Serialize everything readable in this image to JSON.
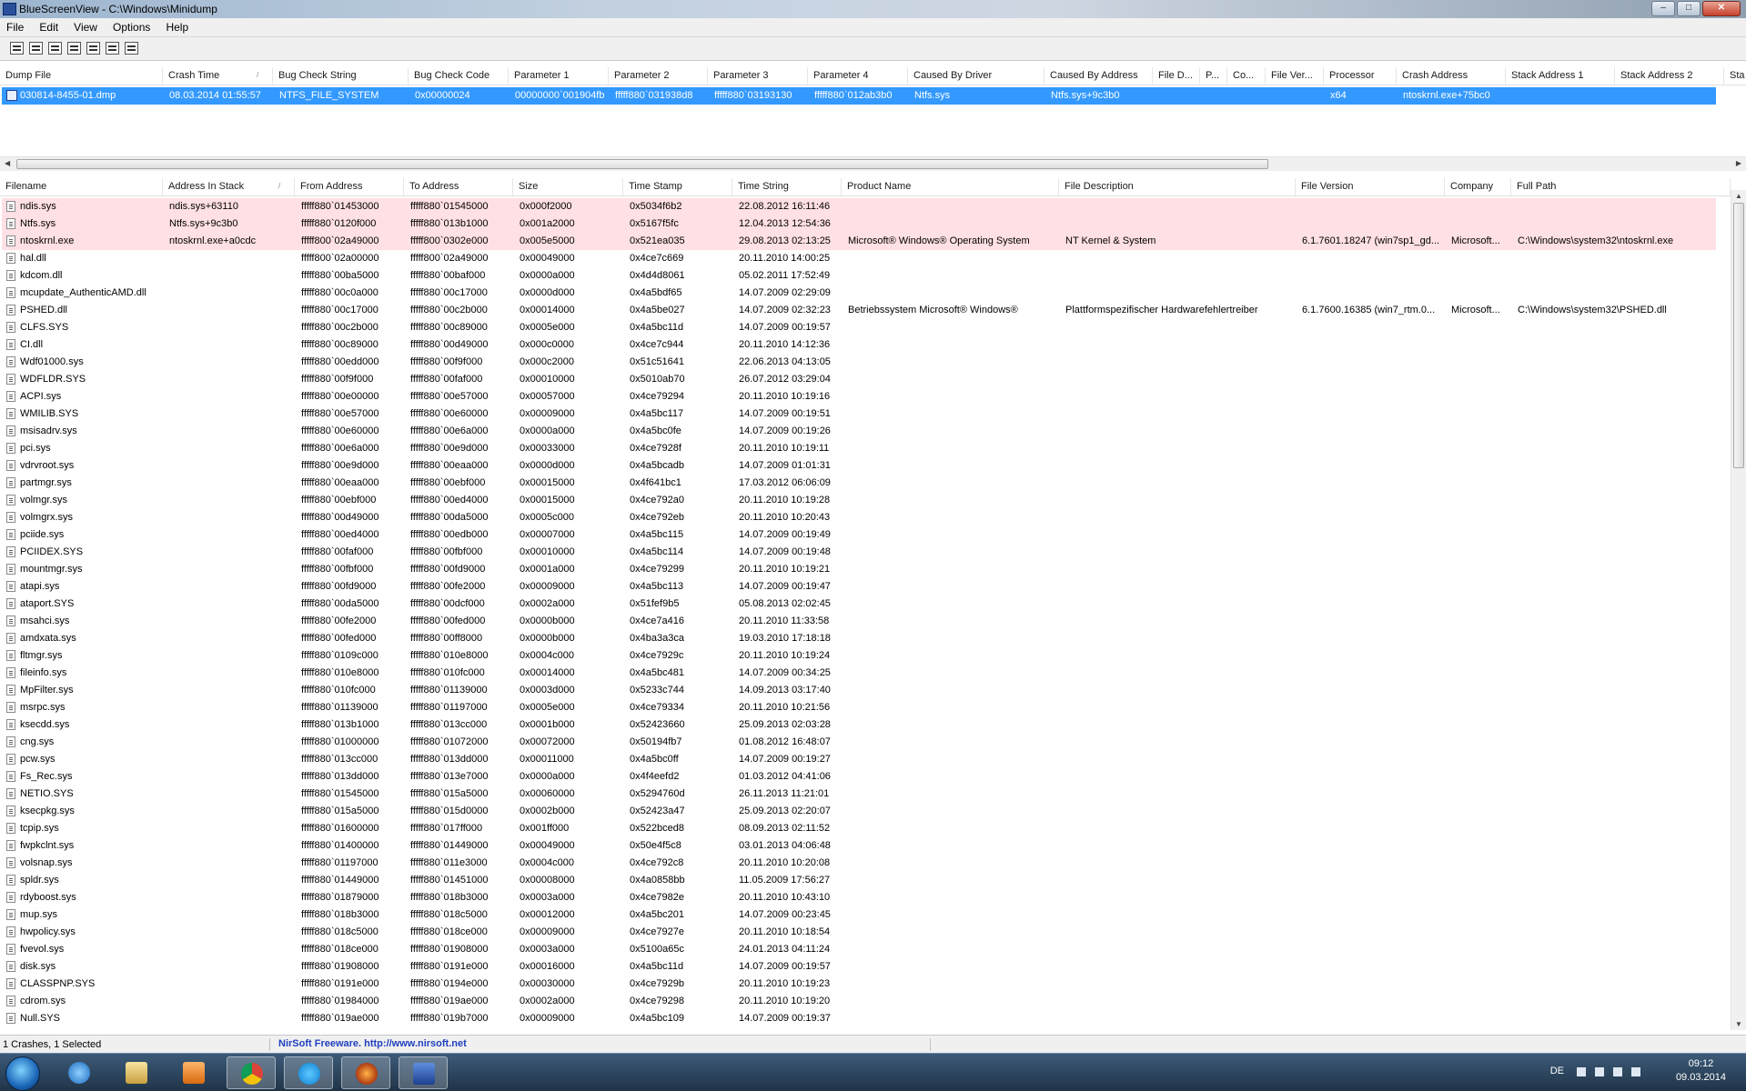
{
  "window": {
    "title": "BlueScreenView  -  C:\\Windows\\Minidump",
    "minimize": "0",
    "maximize": "1",
    "close": "r"
  },
  "menu": [
    "File",
    "Edit",
    "View",
    "Options",
    "Help"
  ],
  "toolbar_icons": [
    "save-icon",
    "save-all-icon",
    "refresh-icon",
    "copy-icon",
    "properties-icon",
    "find-icon",
    "exit-icon"
  ],
  "dump_columns": [
    "Dump File",
    "Crash Time",
    "Bug Check String",
    "Bug Check Code",
    "Parameter 1",
    "Parameter 2",
    "Parameter 3",
    "Parameter 4",
    "Caused By Driver",
    "Caused By Address",
    "File D...",
    "P...",
    "Co...",
    "File Ver...",
    "Processor",
    "Crash Address",
    "Stack Address 1",
    "Stack Address 2",
    "Sta"
  ],
  "dumps": [
    [
      "030814-8455-01.dmp",
      "08.03.2014 01:55:57",
      "NTFS_FILE_SYSTEM",
      "0x00000024",
      "00000000`001904fb",
      "fffff880`031938d8",
      "fffff880`03193130",
      "fffff880`012ab3b0",
      "Ntfs.sys",
      "Ntfs.sys+9c3b0",
      "",
      "",
      "",
      "",
      "x64",
      "ntoskrnl.exe+75bc0",
      "",
      "",
      ""
    ]
  ],
  "driver_columns": [
    "Filename",
    "Address In Stack",
    "From Address",
    "To Address",
    "Size",
    "Time Stamp",
    "Time String",
    "Product Name",
    "File Description",
    "File Version",
    "Company",
    "Full Path"
  ],
  "drivers": [
    [
      "ndis.sys",
      "ndis.sys+63110",
      "fffff880`01453000",
      "fffff880`01545000",
      "0x000f2000",
      "0x5034f6b2",
      "22.08.2012 16:11:46",
      "",
      "",
      "",
      "",
      ""
    ],
    [
      "Ntfs.sys",
      "Ntfs.sys+9c3b0",
      "fffff880`0120f000",
      "fffff880`013b1000",
      "0x001a2000",
      "0x5167f5fc",
      "12.04.2013 12:54:36",
      "",
      "",
      "",
      "",
      ""
    ],
    [
      "ntoskrnl.exe",
      "ntoskrnl.exe+a0cdc",
      "fffff800`02a49000",
      "fffff800`0302e000",
      "0x005e5000",
      "0x521ea035",
      "29.08.2013 02:13:25",
      "Microsoft® Windows® Operating System",
      "NT Kernel & System",
      "6.1.7601.18247 (win7sp1_gd...",
      "Microsoft...",
      "C:\\Windows\\system32\\ntoskrnl.exe"
    ],
    [
      "hal.dll",
      "",
      "fffff800`02a00000",
      "fffff800`02a49000",
      "0x00049000",
      "0x4ce7c669",
      "20.11.2010 14:00:25",
      "",
      "",
      "",
      "",
      ""
    ],
    [
      "kdcom.dll",
      "",
      "fffff880`00ba5000",
      "fffff880`00baf000",
      "0x0000a000",
      "0x4d4d8061",
      "05.02.2011 17:52:49",
      "",
      "",
      "",
      "",
      ""
    ],
    [
      "mcupdate_AuthenticAMD.dll",
      "",
      "fffff880`00c0a000",
      "fffff880`00c17000",
      "0x0000d000",
      "0x4a5bdf65",
      "14.07.2009 02:29:09",
      "",
      "",
      "",
      "",
      ""
    ],
    [
      "PSHED.dll",
      "",
      "fffff880`00c17000",
      "fffff880`00c2b000",
      "0x00014000",
      "0x4a5be027",
      "14.07.2009 02:32:23",
      "Betriebssystem Microsoft® Windows®",
      "Plattformspezifischer Hardwarefehlertreiber",
      "6.1.7600.16385 (win7_rtm.0...",
      "Microsoft...",
      "C:\\Windows\\system32\\PSHED.dll"
    ],
    [
      "CLFS.SYS",
      "",
      "fffff880`00c2b000",
      "fffff880`00c89000",
      "0x0005e000",
      "0x4a5bc11d",
      "14.07.2009 00:19:57",
      "",
      "",
      "",
      "",
      ""
    ],
    [
      "CI.dll",
      "",
      "fffff880`00c89000",
      "fffff880`00d49000",
      "0x000c0000",
      "0x4ce7c944",
      "20.11.2010 14:12:36",
      "",
      "",
      "",
      "",
      ""
    ],
    [
      "Wdf01000.sys",
      "",
      "fffff880`00edd000",
      "fffff880`00f9f000",
      "0x000c2000",
      "0x51c51641",
      "22.06.2013 04:13:05",
      "",
      "",
      "",
      "",
      ""
    ],
    [
      "WDFLDR.SYS",
      "",
      "fffff880`00f9f000",
      "fffff880`00faf000",
      "0x00010000",
      "0x5010ab70",
      "26.07.2012 03:29:04",
      "",
      "",
      "",
      "",
      ""
    ],
    [
      "ACPI.sys",
      "",
      "fffff880`00e00000",
      "fffff880`00e57000",
      "0x00057000",
      "0x4ce79294",
      "20.11.2010 10:19:16",
      "",
      "",
      "",
      "",
      ""
    ],
    [
      "WMILIB.SYS",
      "",
      "fffff880`00e57000",
      "fffff880`00e60000",
      "0x00009000",
      "0x4a5bc117",
      "14.07.2009 00:19:51",
      "",
      "",
      "",
      "",
      ""
    ],
    [
      "msisadrv.sys",
      "",
      "fffff880`00e60000",
      "fffff880`00e6a000",
      "0x0000a000",
      "0x4a5bc0fe",
      "14.07.2009 00:19:26",
      "",
      "",
      "",
      "",
      ""
    ],
    [
      "pci.sys",
      "",
      "fffff880`00e6a000",
      "fffff880`00e9d000",
      "0x00033000",
      "0x4ce7928f",
      "20.11.2010 10:19:11",
      "",
      "",
      "",
      "",
      ""
    ],
    [
      "vdrvroot.sys",
      "",
      "fffff880`00e9d000",
      "fffff880`00eaa000",
      "0x0000d000",
      "0x4a5bcadb",
      "14.07.2009 01:01:31",
      "",
      "",
      "",
      "",
      ""
    ],
    [
      "partmgr.sys",
      "",
      "fffff880`00eaa000",
      "fffff880`00ebf000",
      "0x00015000",
      "0x4f641bc1",
      "17.03.2012 06:06:09",
      "",
      "",
      "",
      "",
      ""
    ],
    [
      "volmgr.sys",
      "",
      "fffff880`00ebf000",
      "fffff880`00ed4000",
      "0x00015000",
      "0x4ce792a0",
      "20.11.2010 10:19:28",
      "",
      "",
      "",
      "",
      ""
    ],
    [
      "volmgrx.sys",
      "",
      "fffff880`00d49000",
      "fffff880`00da5000",
      "0x0005c000",
      "0x4ce792eb",
      "20.11.2010 10:20:43",
      "",
      "",
      "",
      "",
      ""
    ],
    [
      "pciide.sys",
      "",
      "fffff880`00ed4000",
      "fffff880`00edb000",
      "0x00007000",
      "0x4a5bc115",
      "14.07.2009 00:19:49",
      "",
      "",
      "",
      "",
      ""
    ],
    [
      "PCIIDEX.SYS",
      "",
      "fffff880`00faf000",
      "fffff880`00fbf000",
      "0x00010000",
      "0x4a5bc114",
      "14.07.2009 00:19:48",
      "",
      "",
      "",
      "",
      ""
    ],
    [
      "mountmgr.sys",
      "",
      "fffff880`00fbf000",
      "fffff880`00fd9000",
      "0x0001a000",
      "0x4ce79299",
      "20.11.2010 10:19:21",
      "",
      "",
      "",
      "",
      ""
    ],
    [
      "atapi.sys",
      "",
      "fffff880`00fd9000",
      "fffff880`00fe2000",
      "0x00009000",
      "0x4a5bc113",
      "14.07.2009 00:19:47",
      "",
      "",
      "",
      "",
      ""
    ],
    [
      "ataport.SYS",
      "",
      "fffff880`00da5000",
      "fffff880`00dcf000",
      "0x0002a000",
      "0x51fef9b5",
      "05.08.2013 02:02:45",
      "",
      "",
      "",
      "",
      ""
    ],
    [
      "msahci.sys",
      "",
      "fffff880`00fe2000",
      "fffff880`00fed000",
      "0x0000b000",
      "0x4ce7a416",
      "20.11.2010 11:33:58",
      "",
      "",
      "",
      "",
      ""
    ],
    [
      "amdxata.sys",
      "",
      "fffff880`00fed000",
      "fffff880`00ff8000",
      "0x0000b000",
      "0x4ba3a3ca",
      "19.03.2010 17:18:18",
      "",
      "",
      "",
      "",
      ""
    ],
    [
      "fltmgr.sys",
      "",
      "fffff880`0109c000",
      "fffff880`010e8000",
      "0x0004c000",
      "0x4ce7929c",
      "20.11.2010 10:19:24",
      "",
      "",
      "",
      "",
      ""
    ],
    [
      "fileinfo.sys",
      "",
      "fffff880`010e8000",
      "fffff880`010fc000",
      "0x00014000",
      "0x4a5bc481",
      "14.07.2009 00:34:25",
      "",
      "",
      "",
      "",
      ""
    ],
    [
      "MpFilter.sys",
      "",
      "fffff880`010fc000",
      "fffff880`01139000",
      "0x0003d000",
      "0x5233c744",
      "14.09.2013 03:17:40",
      "",
      "",
      "",
      "",
      ""
    ],
    [
      "msrpc.sys",
      "",
      "fffff880`01139000",
      "fffff880`01197000",
      "0x0005e000",
      "0x4ce79334",
      "20.11.2010 10:21:56",
      "",
      "",
      "",
      "",
      ""
    ],
    [
      "ksecdd.sys",
      "",
      "fffff880`013b1000",
      "fffff880`013cc000",
      "0x0001b000",
      "0x52423660",
      "25.09.2013 02:03:28",
      "",
      "",
      "",
      "",
      ""
    ],
    [
      "cng.sys",
      "",
      "fffff880`01000000",
      "fffff880`01072000",
      "0x00072000",
      "0x50194fb7",
      "01.08.2012 16:48:07",
      "",
      "",
      "",
      "",
      ""
    ],
    [
      "pcw.sys",
      "",
      "fffff880`013cc000",
      "fffff880`013dd000",
      "0x00011000",
      "0x4a5bc0ff",
      "14.07.2009 00:19:27",
      "",
      "",
      "",
      "",
      ""
    ],
    [
      "Fs_Rec.sys",
      "",
      "fffff880`013dd000",
      "fffff880`013e7000",
      "0x0000a000",
      "0x4f4eefd2",
      "01.03.2012 04:41:06",
      "",
      "",
      "",
      "",
      ""
    ],
    [
      "NETIO.SYS",
      "",
      "fffff880`01545000",
      "fffff880`015a5000",
      "0x00060000",
      "0x5294760d",
      "26.11.2013 11:21:01",
      "",
      "",
      "",
      "",
      ""
    ],
    [
      "ksecpkg.sys",
      "",
      "fffff880`015a5000",
      "fffff880`015d0000",
      "0x0002b000",
      "0x52423a47",
      "25.09.2013 02:20:07",
      "",
      "",
      "",
      "",
      ""
    ],
    [
      "tcpip.sys",
      "",
      "fffff880`01600000",
      "fffff880`017ff000",
      "0x001ff000",
      "0x522bced8",
      "08.09.2013 02:11:52",
      "",
      "",
      "",
      "",
      ""
    ],
    [
      "fwpkclnt.sys",
      "",
      "fffff880`01400000",
      "fffff880`01449000",
      "0x00049000",
      "0x50e4f5c8",
      "03.01.2013 04:06:48",
      "",
      "",
      "",
      "",
      ""
    ],
    [
      "volsnap.sys",
      "",
      "fffff880`01197000",
      "fffff880`011e3000",
      "0x0004c000",
      "0x4ce792c8",
      "20.11.2010 10:20:08",
      "",
      "",
      "",
      "",
      ""
    ],
    [
      "spldr.sys",
      "",
      "fffff880`01449000",
      "fffff880`01451000",
      "0x00008000",
      "0x4a0858bb",
      "11.05.2009 17:56:27",
      "",
      "",
      "",
      "",
      ""
    ],
    [
      "rdyboost.sys",
      "",
      "fffff880`01879000",
      "fffff880`018b3000",
      "0x0003a000",
      "0x4ce7982e",
      "20.11.2010 10:43:10",
      "",
      "",
      "",
      "",
      ""
    ],
    [
      "mup.sys",
      "",
      "fffff880`018b3000",
      "fffff880`018c5000",
      "0x00012000",
      "0x4a5bc201",
      "14.07.2009 00:23:45",
      "",
      "",
      "",
      "",
      ""
    ],
    [
      "hwpolicy.sys",
      "",
      "fffff880`018c5000",
      "fffff880`018ce000",
      "0x00009000",
      "0x4ce7927e",
      "20.11.2010 10:18:54",
      "",
      "",
      "",
      "",
      ""
    ],
    [
      "fvevol.sys",
      "",
      "fffff880`018ce000",
      "fffff880`01908000",
      "0x0003a000",
      "0x5100a65c",
      "24.01.2013 04:11:24",
      "",
      "",
      "",
      "",
      ""
    ],
    [
      "disk.sys",
      "",
      "fffff880`01908000",
      "fffff880`0191e000",
      "0x00016000",
      "0x4a5bc11d",
      "14.07.2009 00:19:57",
      "",
      "",
      "",
      "",
      ""
    ],
    [
      "CLASSPNP.SYS",
      "",
      "fffff880`0191e000",
      "fffff880`0194e000",
      "0x00030000",
      "0x4ce7929b",
      "20.11.2010 10:19:23",
      "",
      "",
      "",
      "",
      ""
    ],
    [
      "cdrom.sys",
      "",
      "fffff880`01984000",
      "fffff880`019ae000",
      "0x0002a000",
      "0x4ce79298",
      "20.11.2010 10:19:20",
      "",
      "",
      "",
      "",
      ""
    ],
    [
      "Null.SYS",
      "",
      "fffff880`019ae000",
      "fffff880`019b7000",
      "0x00009000",
      "0x4a5bc109",
      "14.07.2009 00:19:37",
      "",
      "",
      "",
      "",
      ""
    ]
  ],
  "highlight_color": "#ffe0e4",
  "selection_color": "#3399ff",
  "status": {
    "count": "1 Crashes, 1 Selected",
    "link": "NirSoft Freeware.  http://www.nirsoft.net"
  },
  "tray": {
    "language": "DE",
    "time": "09:12",
    "date": "09.03.2014"
  },
  "taskbar_apps": [
    "internet-explorer-icon",
    "explorer-icon",
    "media-player-icon",
    "chrome-icon",
    "skype-icon",
    "firefox-icon",
    "bluescreenview-icon"
  ]
}
